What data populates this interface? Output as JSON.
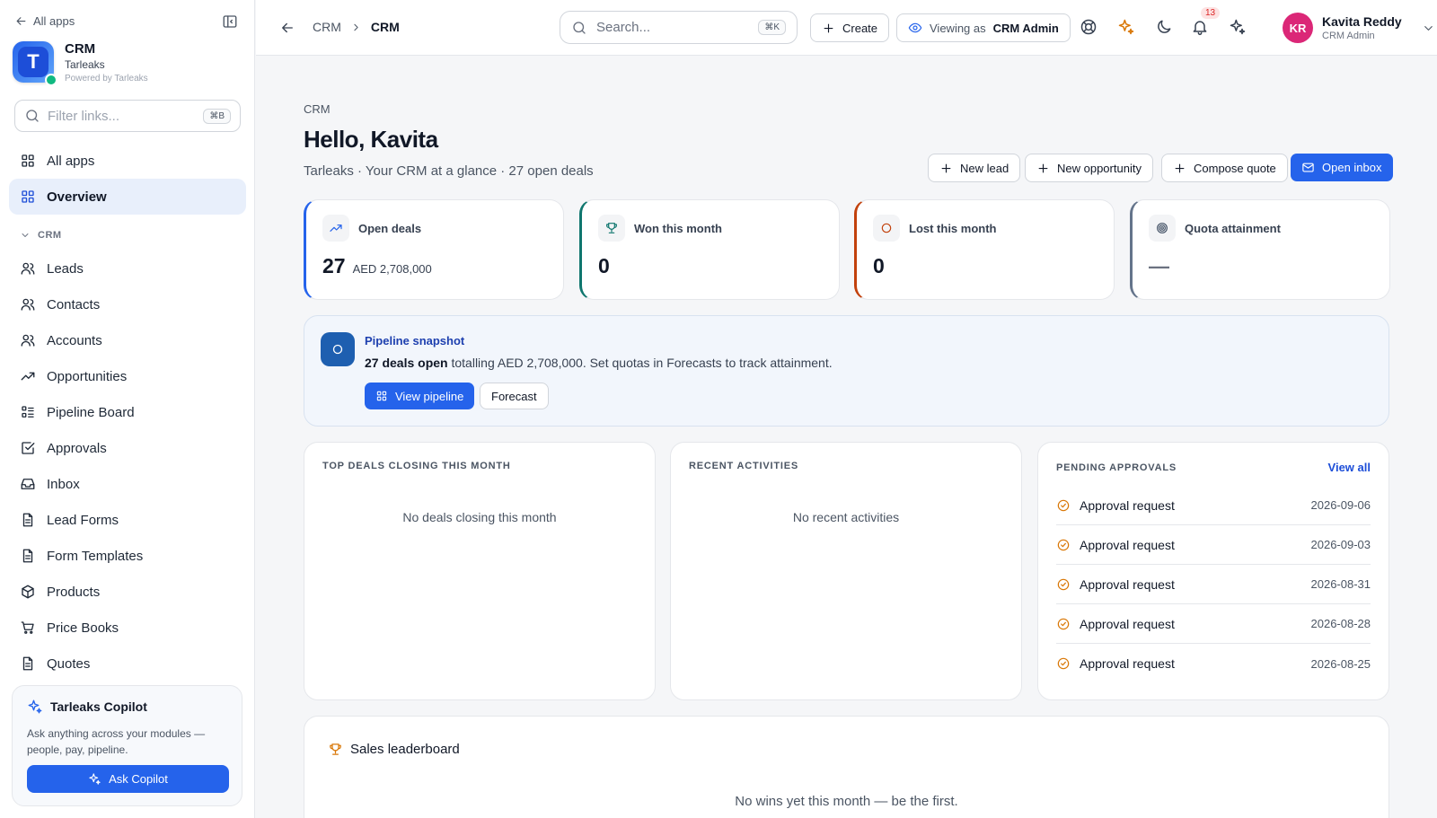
{
  "sidebar": {
    "back_label": "All apps",
    "app": {
      "name": "CRM",
      "org": "Tarleaks",
      "powered": "Powered by Tarleaks",
      "logo_letter": "T"
    },
    "filter": {
      "placeholder": "Filter links...",
      "shortcut": "⌘B"
    },
    "top_items": [
      {
        "label": "All apps",
        "icon": "grid-icon"
      },
      {
        "label": "Overview",
        "icon": "grid-icon",
        "active": true
      }
    ],
    "section_label": "CRM",
    "items": [
      {
        "label": "Leads",
        "icon": "users-icon"
      },
      {
        "label": "Contacts",
        "icon": "users-icon"
      },
      {
        "label": "Accounts",
        "icon": "users-icon"
      },
      {
        "label": "Opportunities",
        "icon": "trending-up-icon"
      },
      {
        "label": "Pipeline Board",
        "icon": "list-icon"
      },
      {
        "label": "Approvals",
        "icon": "check-square-icon"
      },
      {
        "label": "Inbox",
        "icon": "inbox-icon"
      },
      {
        "label": "Lead Forms",
        "icon": "file-icon"
      },
      {
        "label": "Form Templates",
        "icon": "file-icon"
      },
      {
        "label": "Products",
        "icon": "box-icon"
      },
      {
        "label": "Price Books",
        "icon": "cart-icon"
      },
      {
        "label": "Quotes",
        "icon": "file-icon"
      }
    ],
    "copilot": {
      "title": "Tarleaks Copilot",
      "text": "Ask anything across your modules — people, pay, pipeline.",
      "button": "Ask Copilot"
    }
  },
  "topbar": {
    "breadcrumb": [
      "CRM",
      "CRM"
    ],
    "search": {
      "placeholder": "Search...",
      "shortcut": "⌘K"
    },
    "create_label": "Create",
    "viewing_prefix": "Viewing as",
    "viewing_role": "CRM Admin",
    "notification_count": "13",
    "user": {
      "initials": "KR",
      "name": "Kavita Reddy",
      "role": "CRM Admin"
    }
  },
  "main": {
    "crumb": "CRM",
    "greeting": "Hello, Kavita",
    "subtitle": "Tarleaks · Your CRM at a glance · 27 open deals",
    "actions": {
      "new_lead": "New lead",
      "new_opportunity": "New opportunity",
      "compose_quote": "Compose quote",
      "open_inbox": "Open inbox"
    },
    "kpis": [
      {
        "label": "Open deals",
        "value": "27",
        "sub": "AED 2,708,000",
        "accent": "#2563eb",
        "icon": "trending-up-icon"
      },
      {
        "label": "Won this month",
        "value": "0",
        "sub": "",
        "accent": "#0f766e",
        "icon": "trophy-icon"
      },
      {
        "label": "Lost this month",
        "value": "0",
        "sub": "",
        "accent": "#c2410c",
        "icon": "circle-icon"
      },
      {
        "label": "Quota attainment",
        "value": "—",
        "sub": "",
        "accent": "#64748b",
        "icon": "target-icon"
      }
    ],
    "snapshot": {
      "title": "Pipeline snapshot",
      "bold": "27 deals open",
      "text": " totalling AED 2,708,000. Set quotas in Forecasts to track attainment.",
      "view_pipeline": "View pipeline",
      "forecast": "Forecast"
    },
    "top_deals": {
      "title": "TOP DEALS CLOSING THIS MONTH",
      "empty": "No deals closing this month"
    },
    "recent": {
      "title": "RECENT ACTIVITIES",
      "empty": "No recent activities"
    },
    "approvals": {
      "title": "PENDING APPROVALS",
      "view_all": "View all",
      "rows": [
        {
          "label": "Approval request",
          "date": "2026-09-06"
        },
        {
          "label": "Approval request",
          "date": "2026-09-03"
        },
        {
          "label": "Approval request",
          "date": "2026-08-31"
        },
        {
          "label": "Approval request",
          "date": "2026-08-28"
        },
        {
          "label": "Approval request",
          "date": "2026-08-25"
        }
      ]
    },
    "leaderboard": {
      "title": "Sales leaderboard",
      "empty": "No wins yet this month — be the first."
    }
  },
  "colors": {
    "primary": "#2563eb",
    "active_nav": "#e8effb",
    "avatar": "#db2777",
    "accent_gold": "#d97706"
  }
}
